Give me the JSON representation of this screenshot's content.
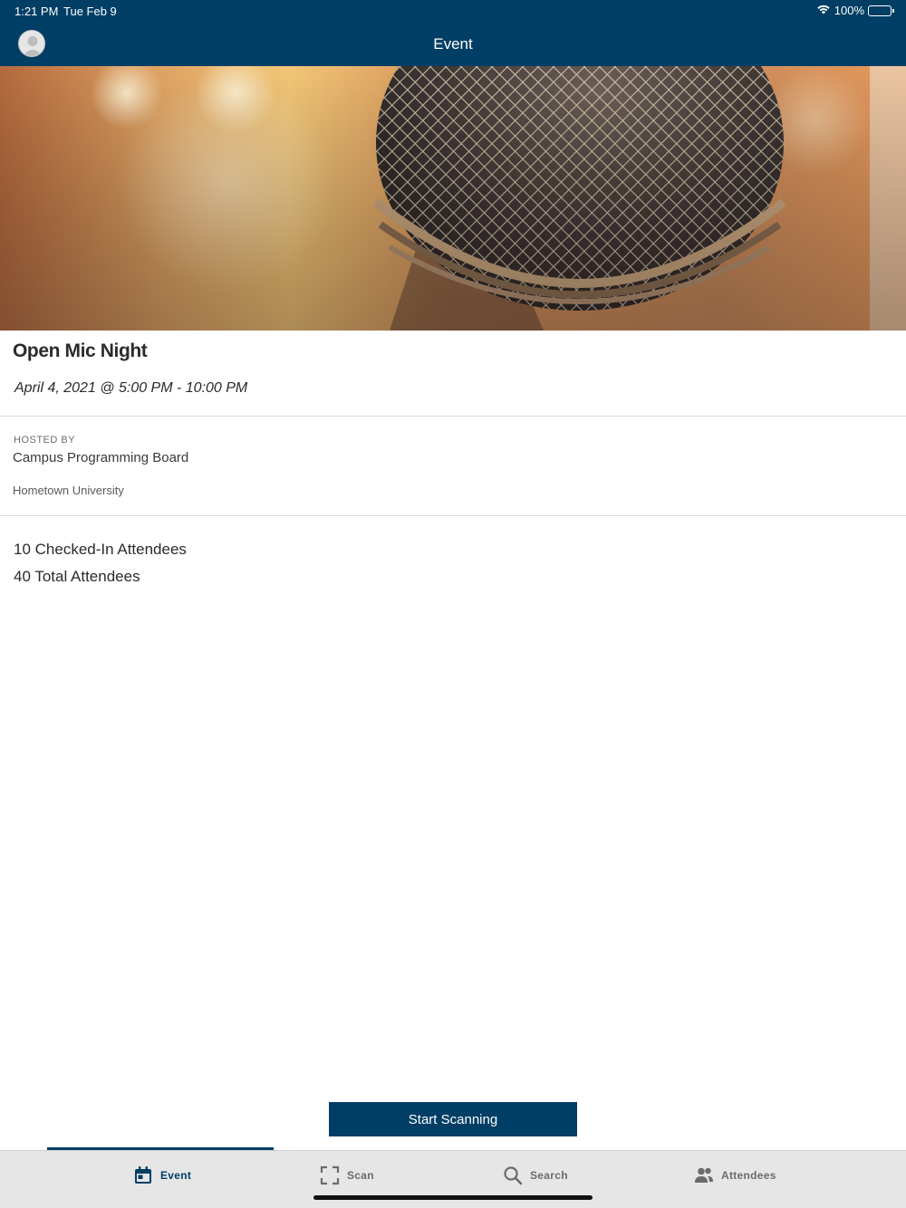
{
  "status_bar": {
    "time": "1:21 PM",
    "date": "Tue Feb 9",
    "battery": "100%",
    "wifi_icon": "wifi-icon",
    "battery_icon": "battery-icon"
  },
  "nav": {
    "title": "Event",
    "avatar_icon": "user-avatar-icon"
  },
  "event": {
    "hero_image": "microphone-photo",
    "title": "Open Mic Night",
    "date": "April 4, 2021 @ 5:00 PM - 10:00 PM",
    "hosted_label": "HOSTED BY",
    "host_name": "Campus Programming Board",
    "host_org": "Hometown University",
    "checked_in": "10 Checked-In Attendees",
    "total": "40 Total Attendees"
  },
  "actions": {
    "start_scanning": "Start Scanning"
  },
  "tabs": [
    {
      "label": "Event",
      "icon": "calendar-icon",
      "active": true
    },
    {
      "label": "Scan",
      "icon": "scan-frame-icon",
      "active": false
    },
    {
      "label": "Search",
      "icon": "search-icon",
      "active": false
    },
    {
      "label": "Attendees",
      "icon": "people-icon",
      "active": false
    }
  ],
  "colors": {
    "brand": "#003e65",
    "tab_bar": "#e6e6e6",
    "inactive_tab": "#6b6b6b"
  }
}
